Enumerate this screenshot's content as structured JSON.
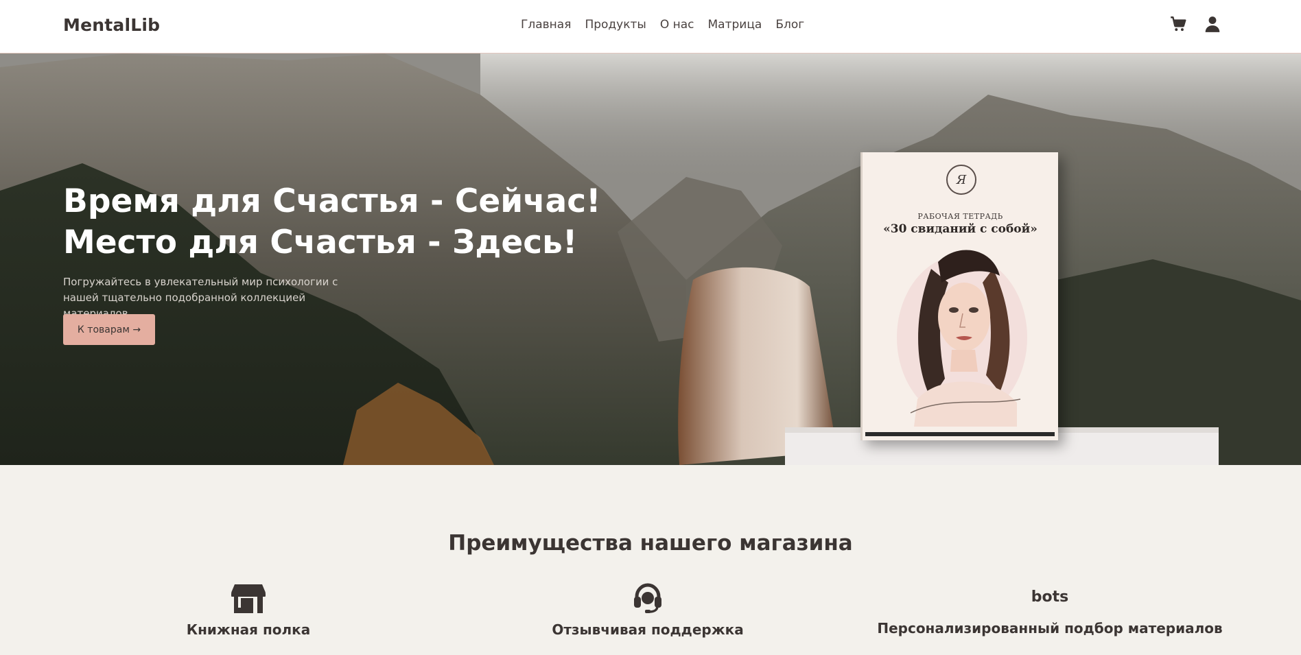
{
  "brand": "MentalLib",
  "nav": {
    "links": [
      "Главная",
      "Продукты",
      "О нас",
      "Матрица",
      "Блог"
    ]
  },
  "icons": {
    "cart": "cart-icon",
    "user": "user-icon"
  },
  "hero": {
    "title_line1": "Время для Счастья - Сейчас!",
    "title_line2": "Место для Счастья - Здесь!",
    "subtitle": "Погружайтесь в увлекательный мир психологии с нашей тщательно подобранной коллекцией материалов.",
    "button_label": "К товарам →",
    "book": {
      "label": "РАБОЧАЯ ТЕТРАДЬ",
      "title": "«30 свиданий с собой»"
    }
  },
  "features": {
    "heading": "Преимущества нашего магазина",
    "items": [
      {
        "label": "Книжная полка",
        "icon": "store-icon"
      },
      {
        "label": "Отзывчивая поддержка",
        "icon": "headset-icon"
      },
      {
        "label": "Персонализированный подбор материалов",
        "icon": "bots-icon",
        "logo_text": "bots"
      }
    ]
  }
}
